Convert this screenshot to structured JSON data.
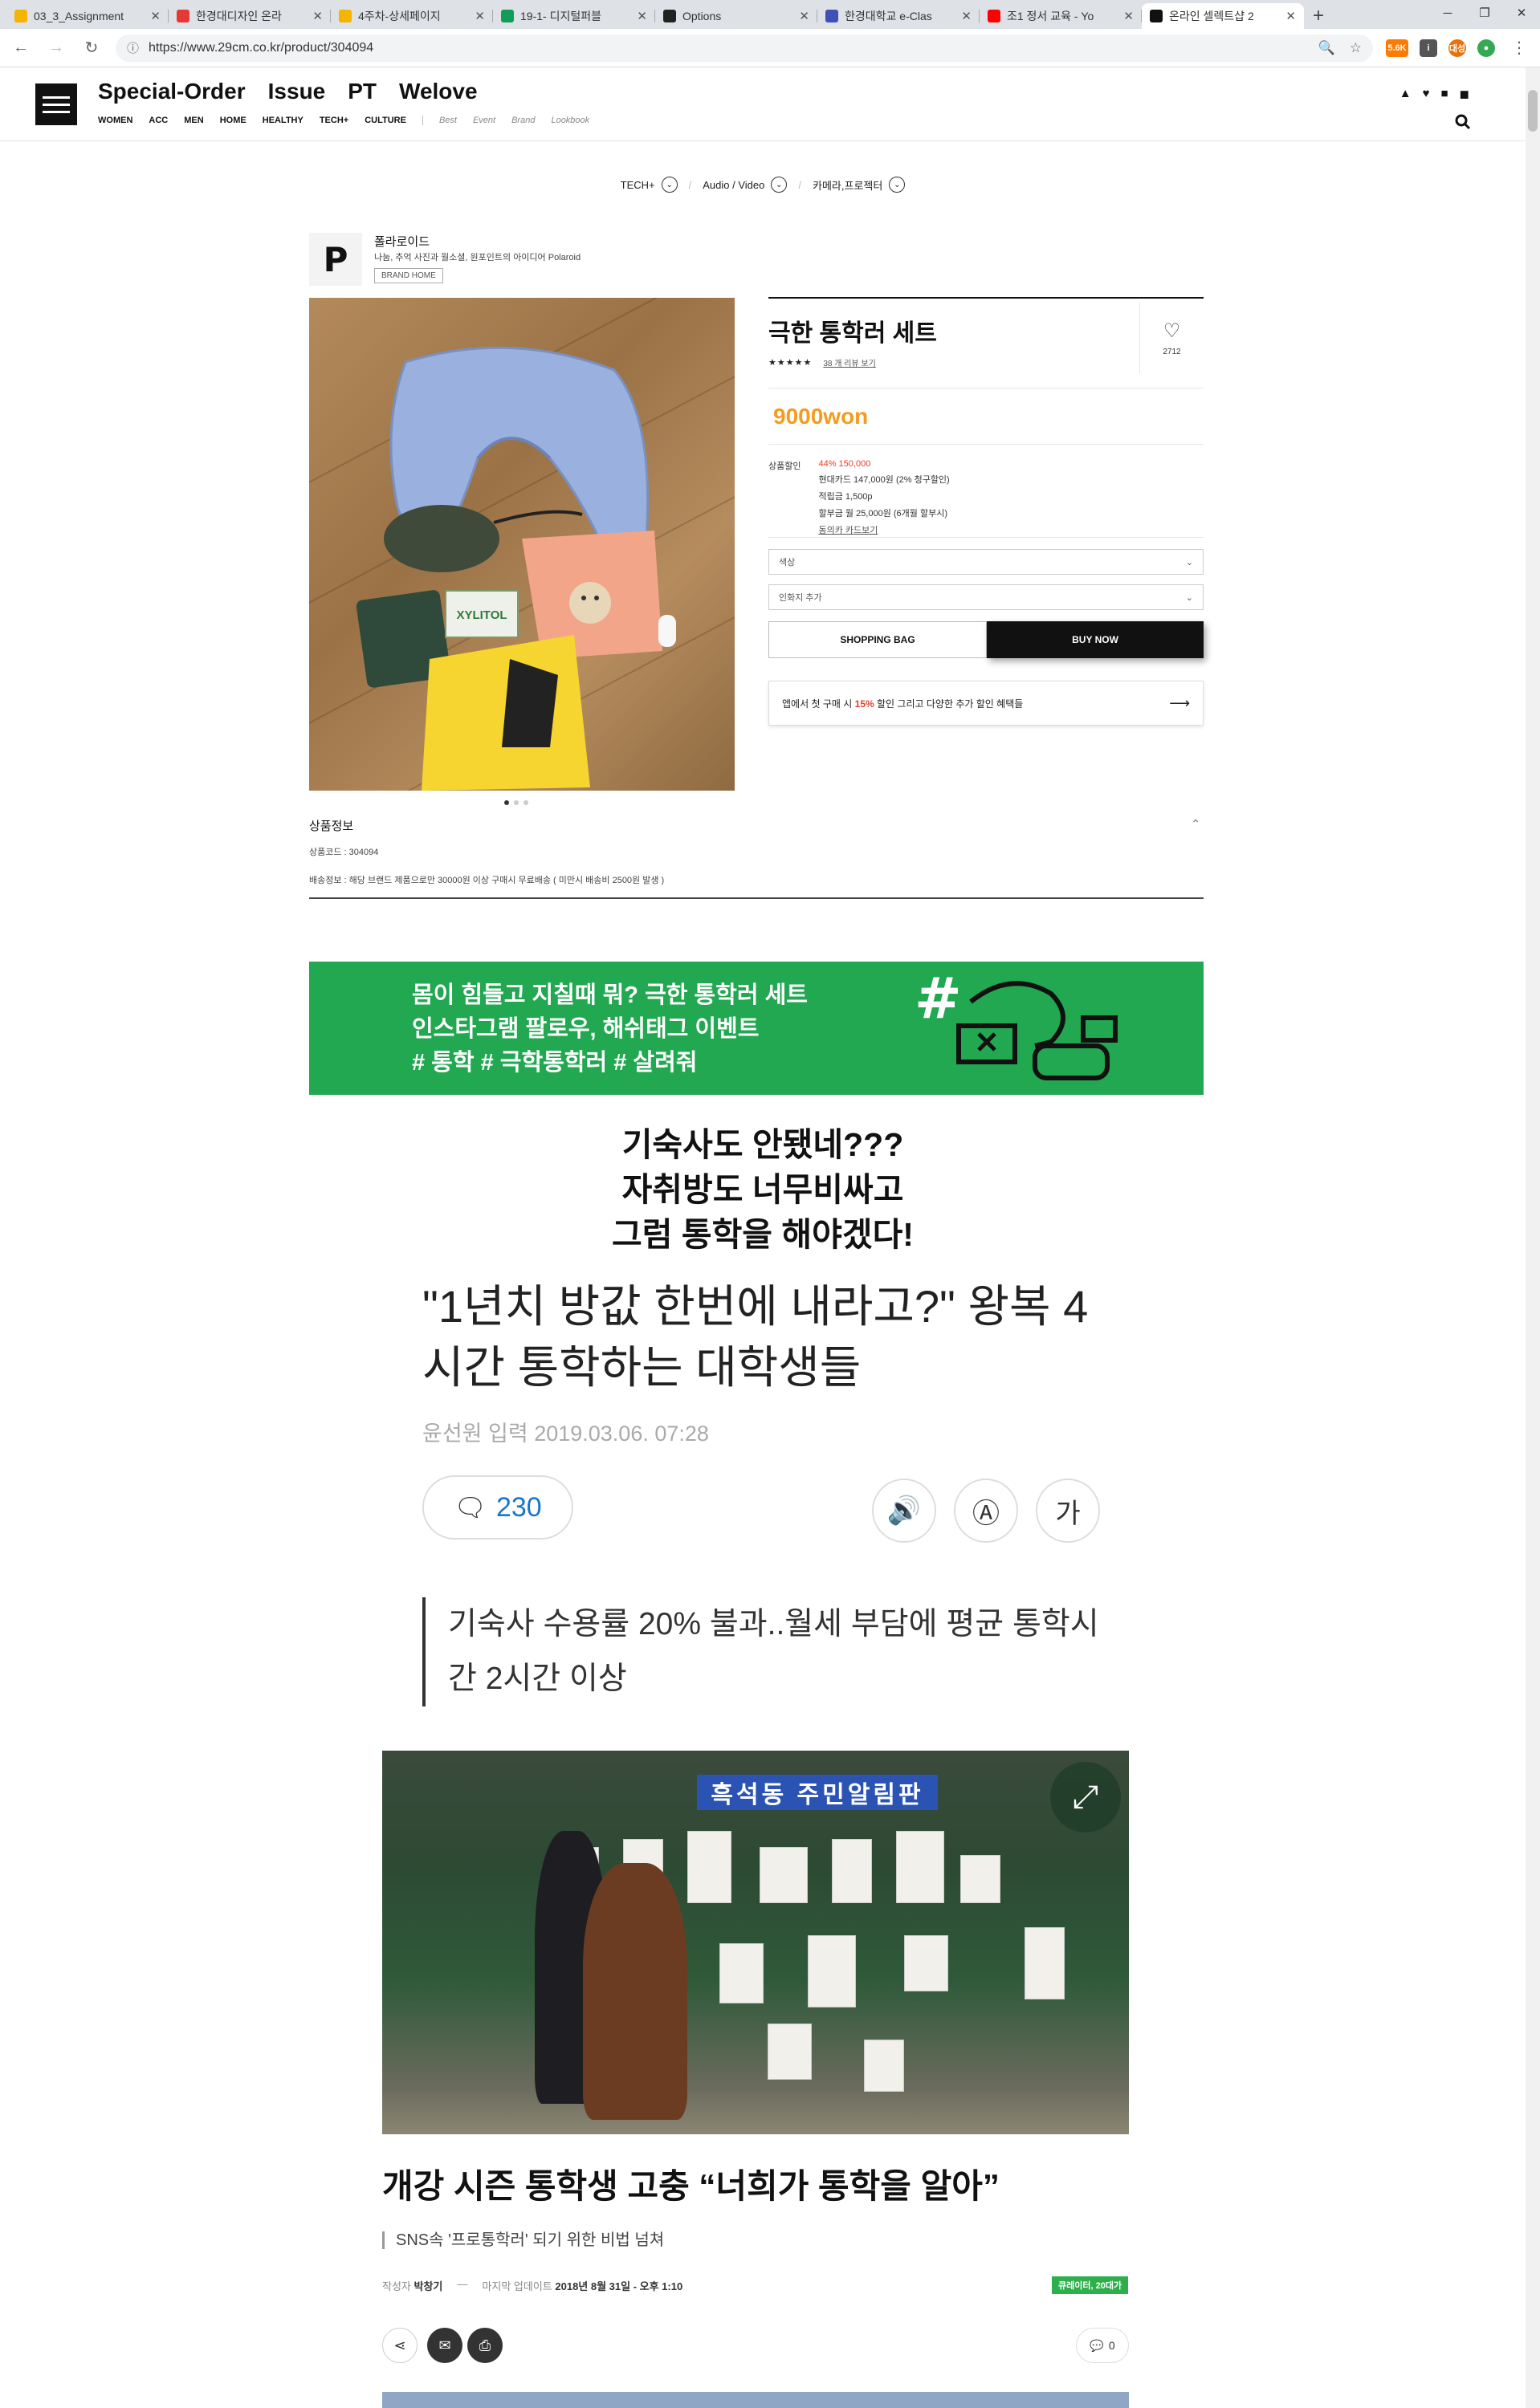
{
  "browser": {
    "tabs": [
      {
        "label": "03_3_Assignment",
        "icon_color": "#f4b400",
        "active": false
      },
      {
        "label": "한경대디자인 온라",
        "icon_color": "#e53935",
        "active": false
      },
      {
        "label": "4주차-상세페이지",
        "icon_color": "#f4b400",
        "active": false
      },
      {
        "label": "19-1- 디지털퍼블",
        "icon_color": "#0f9d58",
        "active": false
      },
      {
        "label": "Options",
        "icon_color": "#222222",
        "active": false
      },
      {
        "label": "한경대학교 e-Clas",
        "icon_color": "#3f51b5",
        "active": false
      },
      {
        "label": "조1 정서 교육 - Yo",
        "icon_color": "#ff0000",
        "active": false
      },
      {
        "label": "온라인 셀렉트샵 2",
        "icon_color": "#111111",
        "active": true
      }
    ],
    "url": "https://www.29cm.co.kr/product/304094",
    "new_tab": "+",
    "ext_badge": "5.6K",
    "profile": "대성"
  },
  "site": {
    "topnav": [
      "Special-Order",
      "Issue",
      "PT",
      "Welove"
    ],
    "subnav": [
      "WOMEN",
      "ACC",
      "MEN",
      "HOME",
      "HEALTHY",
      "TECH+",
      "CULTURE"
    ],
    "subnav_muted": [
      "Best",
      "Event",
      "Brand",
      "Lookbook"
    ]
  },
  "breadcrumb": [
    "TECH+",
    "Audio / Video",
    "카메라,프로젝터"
  ],
  "brand": {
    "initial": "P",
    "name": "폴라로이드",
    "description": "나눔, 추억 사진과 월소셜, 원포인트의 아이디어 Polaroid",
    "home_button": "BRAND HOME"
  },
  "product": {
    "name": "극한 통학러 세트",
    "stars": "★★★★★",
    "review_link": "38 개 리뷰 보기",
    "like_count": "2712",
    "price": "9000won",
    "discount_label": "상품할인",
    "discount_lines": [
      "44% 150,000",
      "현대카드 147,000원 (2% 청구할인)",
      "적립금 1,500p",
      "할부금 월 25,000원 (6개월 할부시)",
      "동의카 카드보기"
    ],
    "option_1": "색상",
    "option_2": "인화지 추가",
    "bag_button": "SHOPPING BAG",
    "buy_button": "BUY NOW",
    "promo_prefix": "앱에서 첫 구매 시",
    "promo_pct": "15%",
    "promo_suffix": "할인 그리고 다양한 추가 할인 혜택들",
    "promo_arrow": "⟶"
  },
  "product_info": {
    "title": "상품정보",
    "code": "상품코드 : 304094",
    "shipping": "배송정보 : 해당 브랜드 제품으로만 30000원 이상 구매시 무료배송 ( 미만시 배송비 2500원 발생 )"
  },
  "banner": {
    "line1": "몸이 힘들고 지칠때 뭐? 극한 통학러 세트",
    "line2": "인스타그램 팔로우, 해쉬태그 이벤트",
    "line3": "# 통학 # 극학통학러 # 살려줘",
    "bg_color": "#21a851"
  },
  "headline": [
    "기숙사도 안됐네???",
    "자취방도 너무비싸고",
    "그럼 통학을 해야겠다!"
  ],
  "news": {
    "title": "\"1년치 방값 한번에 내라고?\" 왕복 4시간 통학하는 대학생들",
    "byline": "윤선원   입력 2019.03.06. 07:28",
    "comment_count": "230",
    "buttons": [
      "🔊",
      "Ⓐ",
      "가"
    ],
    "quote": "기숙사 수용률 20% 불과..월세 부담에 평균 통학시간 2시간 이상",
    "photo_sign": "흑석동 주민알림판"
  },
  "news2": {
    "title": "개강 시즌 통학생 고충 “너희가 통학을 알아”",
    "subtitle": "SNS속 '프로통학러' 되기 위한 비법 넘쳐",
    "writer_label": "작성자",
    "writer": "박창기",
    "updated_label": "마지막 업데이트",
    "updated": "2018년 8월 31일 - 오후 1:10",
    "tag": "큐레이터, 20대가",
    "comments": "0"
  }
}
